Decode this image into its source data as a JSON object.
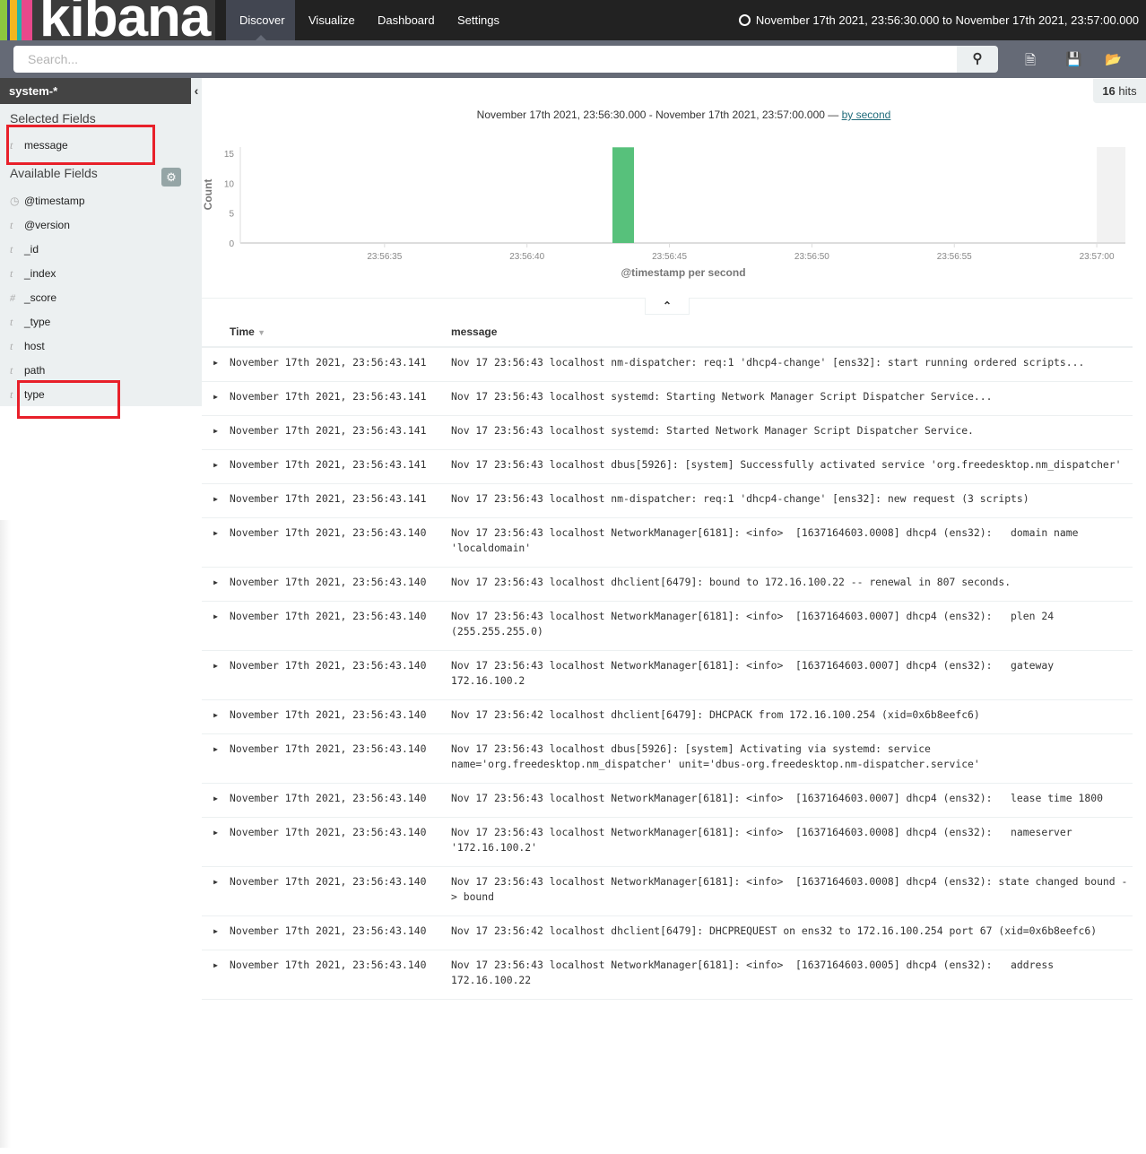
{
  "app": {
    "logo_text": "kibana",
    "logo_colors": [
      "#8cc63f",
      "#2d3b8d",
      "#f3b61f",
      "#24b3a8",
      "#e8488b"
    ]
  },
  "nav": {
    "items": [
      {
        "label": "Discover",
        "active": true
      },
      {
        "label": "Visualize"
      },
      {
        "label": "Dashboard"
      },
      {
        "label": "Settings"
      }
    ]
  },
  "timerange": {
    "icon": "clock-icon",
    "label": "November 17th 2021, 23:56:30.000 to November 17th 2021, 23:57:00.000"
  },
  "search": {
    "placeholder": "Search...",
    "value": "",
    "button_icon": "search-icon"
  },
  "toolbar": {
    "icons": [
      "new-search-icon",
      "save-icon",
      "open-icon"
    ]
  },
  "sidebar": {
    "index_pattern": "system-*",
    "selected_title": "Selected Fields",
    "selected": [
      {
        "type": "t",
        "name": "message"
      }
    ],
    "available_title": "Available Fields",
    "available": [
      {
        "type": "clock",
        "name": "@timestamp"
      },
      {
        "type": "t",
        "name": "@version"
      },
      {
        "type": "t",
        "name": "_id"
      },
      {
        "type": "t",
        "name": "_index"
      },
      {
        "type": "#",
        "name": "_score"
      },
      {
        "type": "t",
        "name": "_type"
      },
      {
        "type": "t",
        "name": "host"
      },
      {
        "type": "t",
        "name": "path"
      },
      {
        "type": "t",
        "name": "type"
      }
    ]
  },
  "hits": {
    "count": "16",
    "label": "hits"
  },
  "chart_header": {
    "range": "November 17th 2021, 23:56:30.000 - November 17th 2021, 23:57:00.000 —",
    "interval_link": "by second"
  },
  "chart_data": {
    "type": "bar",
    "xlabel": "@timestamp per second",
    "ylabel": "Count",
    "x": [
      "23:56:43"
    ],
    "values": [
      16
    ],
    "xlim": [
      "23:56:30",
      "23:57:01"
    ],
    "ylim": [
      0,
      16
    ],
    "xticks": [
      "23:56:35",
      "23:56:40",
      "23:56:45",
      "23:56:50",
      "23:56:55",
      "23:57:00"
    ],
    "yticks": [
      0,
      5,
      10,
      15
    ],
    "bar_color": "#57c17b",
    "grid": false
  },
  "table": {
    "columns": [
      "Time",
      "message"
    ],
    "rows": [
      {
        "time": "November 17th 2021, 23:56:43.141",
        "message": "Nov 17 23:56:43 localhost nm-dispatcher: req:1 'dhcp4-change' [ens32]: start running ordered scripts..."
      },
      {
        "time": "November 17th 2021, 23:56:43.141",
        "message": "Nov 17 23:56:43 localhost systemd: Starting Network Manager Script Dispatcher Service..."
      },
      {
        "time": "November 17th 2021, 23:56:43.141",
        "message": "Nov 17 23:56:43 localhost systemd: Started Network Manager Script Dispatcher Service."
      },
      {
        "time": "November 17th 2021, 23:56:43.141",
        "message": "Nov 17 23:56:43 localhost dbus[5926]: [system] Successfully activated service 'org.freedesktop.nm_dispatcher'"
      },
      {
        "time": "November 17th 2021, 23:56:43.141",
        "message": "Nov 17 23:56:43 localhost nm-dispatcher: req:1 'dhcp4-change' [ens32]: new request (3 scripts)"
      },
      {
        "time": "November 17th 2021, 23:56:43.140",
        "message": "Nov 17 23:56:43 localhost NetworkManager[6181]: <info>  [1637164603.0008] dhcp4 (ens32):   domain name 'localdomain'"
      },
      {
        "time": "November 17th 2021, 23:56:43.140",
        "message": "Nov 17 23:56:43 localhost dhclient[6479]: bound to 172.16.100.22 -- renewal in 807 seconds."
      },
      {
        "time": "November 17th 2021, 23:56:43.140",
        "message": "Nov 17 23:56:43 localhost NetworkManager[6181]: <info>  [1637164603.0007] dhcp4 (ens32):   plen 24 (255.255.255.0)"
      },
      {
        "time": "November 17th 2021, 23:56:43.140",
        "message": "Nov 17 23:56:43 localhost NetworkManager[6181]: <info>  [1637164603.0007] dhcp4 (ens32):   gateway 172.16.100.2"
      },
      {
        "time": "November 17th 2021, 23:56:43.140",
        "message": "Nov 17 23:56:42 localhost dhclient[6479]: DHCPACK from 172.16.100.254 (xid=0x6b8eefc6)"
      },
      {
        "time": "November 17th 2021, 23:56:43.140",
        "message": "Nov 17 23:56:43 localhost dbus[5926]: [system] Activating via systemd: service name='org.freedesktop.nm_dispatcher' unit='dbus-org.freedesktop.nm-dispatcher.service'"
      },
      {
        "time": "November 17th 2021, 23:56:43.140",
        "message": "Nov 17 23:56:43 localhost NetworkManager[6181]: <info>  [1637164603.0007] dhcp4 (ens32):   lease time 1800"
      },
      {
        "time": "November 17th 2021, 23:56:43.140",
        "message": "Nov 17 23:56:43 localhost NetworkManager[6181]: <info>  [1637164603.0008] dhcp4 (ens32):   nameserver '172.16.100.2'"
      },
      {
        "time": "November 17th 2021, 23:56:43.140",
        "message": "Nov 17 23:56:43 localhost NetworkManager[6181]: <info>  [1637164603.0008] dhcp4 (ens32): state changed bound -> bound"
      },
      {
        "time": "November 17th 2021, 23:56:43.140",
        "message": "Nov 17 23:56:42 localhost dhclient[6479]: DHCPREQUEST on ens32 to 172.16.100.254 port 67 (xid=0x6b8eefc6)"
      },
      {
        "time": "November 17th 2021, 23:56:43.140",
        "message": "Nov 17 23:56:43 localhost NetworkManager[6181]: <info>  [1637164603.0005] dhcp4 (ens32):   address 172.16.100.22"
      }
    ]
  }
}
